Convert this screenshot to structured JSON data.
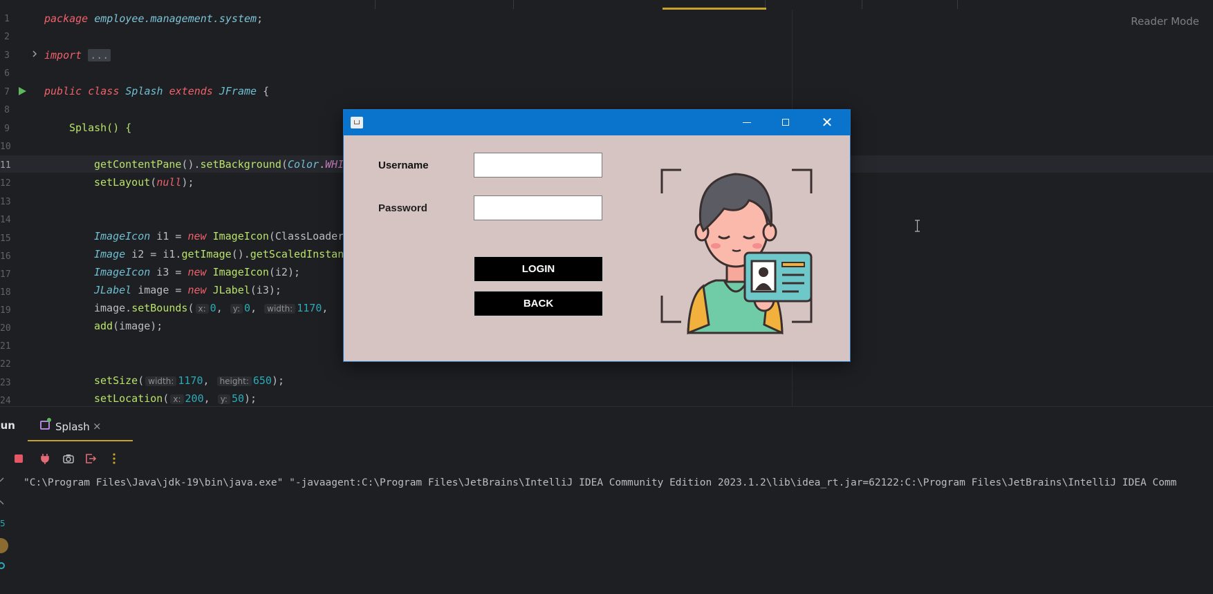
{
  "editor": {
    "reader_mode": "Reader Mode",
    "line_numbers": [
      "1",
      "2",
      "3",
      "6",
      "7",
      "8",
      "9",
      "10",
      "11",
      "12",
      "13",
      "14",
      "15",
      "16",
      "17",
      "18",
      "19",
      "20",
      "21",
      "22",
      "23",
      "24"
    ],
    "code": {
      "l1_kw": "package",
      "l1_pkg": "employee.management.system",
      "l1_end": ";",
      "l3_kw": "import",
      "l3_fold": "...",
      "l7_a": "public",
      "l7_b": "class",
      "l7_c": "Splash",
      "l7_d": "extends",
      "l7_e": "JFrame",
      "l7_f": " {",
      "l9": "Splash() {",
      "l11_fn": "getContentPane",
      "l11_b": "().",
      "l11_fn2": "setBackground",
      "l11_c": "(",
      "l11_cls": "Color",
      "l11_d": ".",
      "l11_fld": "WHI",
      "l12_fn": "setLayout",
      "l12_a": "(",
      "l12_kw": "null",
      "l12_b": ");",
      "l15_cls": "ImageIcon",
      "l15_a": " i1 = ",
      "l15_kw": "new",
      "l15_fn": "ImageIcon",
      "l15_b": "(ClassLoader",
      "l16_cls": "Image",
      "l16_a": " i2 = i1.",
      "l16_fn": "getImage",
      "l16_b": "().",
      "l16_fn2": "getScaledInstan",
      "l17_cls": "ImageIcon",
      "l17_a": " i3 = ",
      "l17_kw": "new",
      "l17_fn": "ImageIcon",
      "l17_b": "(i2);",
      "l18_cls": "JLabel",
      "l18_a": " image = ",
      "l18_kw": "new",
      "l18_fn": "JLabel",
      "l18_b": "(i3);",
      "l19_a": "image.",
      "l19_fn": "setBounds",
      "l19_b": "(",
      "l19_h1": "x:",
      "l19_v1": "0",
      "l19_c": ", ",
      "l19_h2": "y:",
      "l19_v2": "0",
      "l19_d": ", ",
      "l19_h3": "width:",
      "l19_v3": "1170",
      "l19_e": ",",
      "l20_fn": "add",
      "l20_a": "(image);",
      "l23_fn": "setSize",
      "l23_a": "(",
      "l23_h1": "width:",
      "l23_v1": "1170",
      "l23_b": ", ",
      "l23_h2": "height:",
      "l23_v2": "650",
      "l23_c": ");",
      "l24_fn": "setLocation",
      "l24_a": "(",
      "l24_h1": "x:",
      "l24_v1": "200",
      "l24_b": ", ",
      "l24_h2": "y:",
      "l24_v2": "50",
      "l24_c": ");"
    }
  },
  "run_panel": {
    "label": "Run",
    "tab_label": "Splash",
    "tab_close": "×",
    "side_number": "5",
    "console": "\"C:\\Program Files\\Java\\jdk-19\\bin\\java.exe\" \"-javaagent:C:\\Program Files\\JetBrains\\IntelliJ IDEA Community Edition 2023.1.2\\lib\\idea_rt.jar=62122:C:\\Program Files\\JetBrains\\IntelliJ IDEA Comm"
  },
  "dialog": {
    "username_label": "Username",
    "password_label": "Password",
    "username_value": "",
    "password_value": "",
    "login_label": "LOGIN",
    "back_label": "BACK",
    "close_glyph": "✕"
  },
  "colors": {
    "titlebar": "#0a73cc",
    "dialog_bg": "#d6c4c2",
    "button_bg": "#000000",
    "accent": "#c9a227"
  }
}
